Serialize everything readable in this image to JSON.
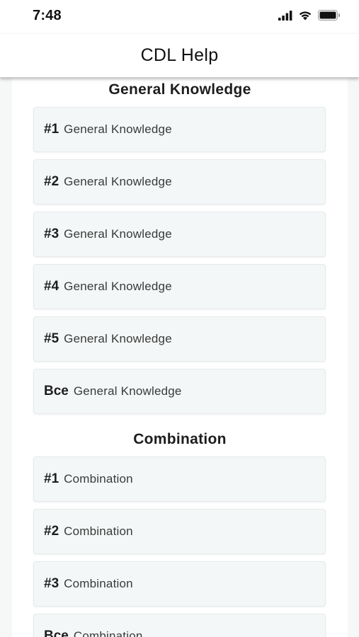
{
  "status_bar": {
    "time": "7:48",
    "icons": [
      "cellular-signal-icon",
      "wifi-icon",
      "battery-icon"
    ]
  },
  "nav": {
    "title": "CDL Help"
  },
  "sections": [
    {
      "title": "General Knowledge",
      "items": [
        {
          "num": "#1",
          "label": "General Knowledge"
        },
        {
          "num": "#2",
          "label": "General Knowledge"
        },
        {
          "num": "#3",
          "label": "General Knowledge"
        },
        {
          "num": "#4",
          "label": "General Knowledge"
        },
        {
          "num": "#5",
          "label": "General Knowledge"
        },
        {
          "num": "Все",
          "label": "General Knowledge"
        }
      ]
    },
    {
      "title": "Combination",
      "items": [
        {
          "num": "#1",
          "label": "Combination"
        },
        {
          "num": "#2",
          "label": "Combination"
        },
        {
          "num": "#3",
          "label": "Combination"
        },
        {
          "num": "Все",
          "label": "Combination"
        }
      ]
    }
  ]
}
